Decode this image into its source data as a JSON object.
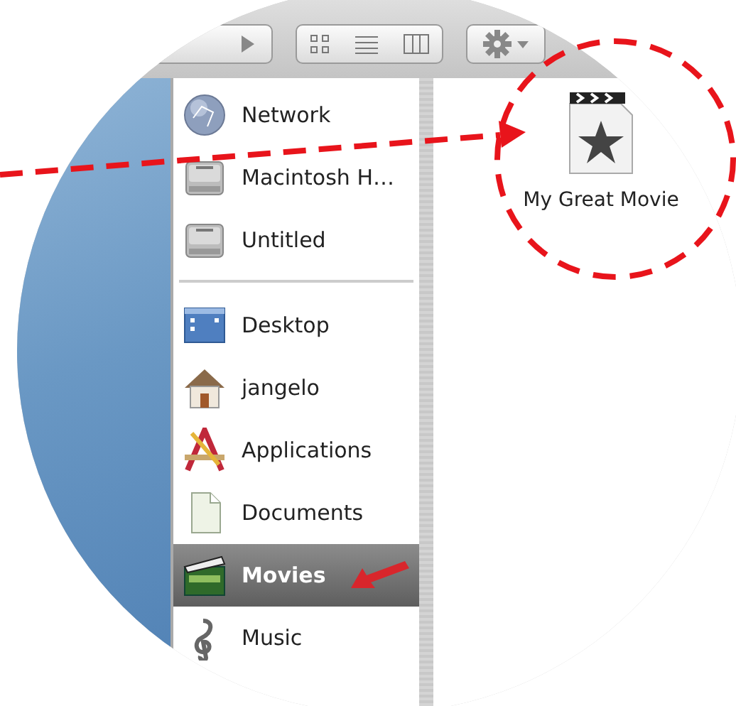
{
  "sidebar": {
    "sections": [
      {
        "items": [
          {
            "label": "Network",
            "kind": "network",
            "selected": false
          },
          {
            "label": "Macintosh H…",
            "kind": "disk",
            "selected": false
          },
          {
            "label": "Untitled",
            "kind": "disk",
            "selected": false
          }
        ]
      },
      {
        "items": [
          {
            "label": "Desktop",
            "kind": "desktop",
            "selected": false
          },
          {
            "label": "jangelo",
            "kind": "home",
            "selected": false
          },
          {
            "label": "Applications",
            "kind": "applications",
            "selected": false
          },
          {
            "label": "Documents",
            "kind": "documents",
            "selected": false
          },
          {
            "label": "Movies",
            "kind": "movies",
            "selected": true
          },
          {
            "label": "Music",
            "kind": "music",
            "selected": false
          }
        ]
      }
    ]
  },
  "files": [
    {
      "name": "My Great Movie"
    }
  ]
}
